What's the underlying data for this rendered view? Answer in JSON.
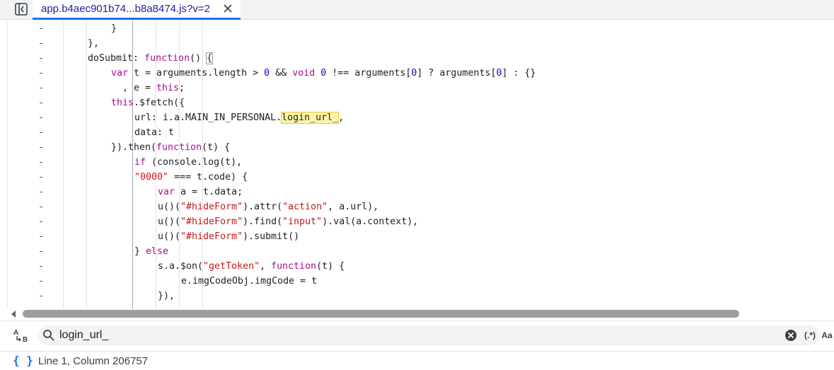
{
  "tab": {
    "title": "app.b4aec901b74...b8a8474.js?v=2"
  },
  "editor": {
    "gutter_marker": "-",
    "lines": [
      {
        "indent": 3,
        "html": "}"
      },
      {
        "indent": 2,
        "html": "},"
      },
      {
        "indent": 2,
        "html": "doSubmit: <span class=\"kw\">function</span>() <span class=\"bracket\">{</span>"
      },
      {
        "indent": 3,
        "html": "<span class=\"kw\">var</span> t = arguments.length &gt; <span class=\"num\">0</span> &amp;&amp; <span class=\"kw\">void</span> <span class=\"num\">0</span> !== arguments[<span class=\"num\">0</span>] ? arguments[<span class=\"num\">0</span>] : {}"
      },
      {
        "indent": 3,
        "html": "  , e = <span class=\"kw\">this</span>;"
      },
      {
        "indent": 3,
        "html": "<span class=\"kw\">this</span>.$fetch({"
      },
      {
        "indent": 4,
        "html": "url: i.a.MAIN_IN_PERSONAL.<span class=\"hl\">login_url_</span>,"
      },
      {
        "indent": 4,
        "html": "data: t"
      },
      {
        "indent": 3,
        "html": "}).then(<span class=\"kw\">function</span>(t) {"
      },
      {
        "indent": 4,
        "html": "<span class=\"kw\">if</span> (console.log(t),"
      },
      {
        "indent": 4,
        "html": "<span class=\"str\">\"0000\"</span> === t.code) {"
      },
      {
        "indent": 5,
        "html": "<span class=\"kw\">var</span> a = t.data;"
      },
      {
        "indent": 5,
        "html": "u()(<span class=\"str\">\"#hideForm\"</span>).attr(<span class=\"str\">\"action\"</span>, a.url),"
      },
      {
        "indent": 5,
        "html": "u()(<span class=\"str\">\"#hideForm\"</span>).find(<span class=\"str\">\"input\"</span>).val(a.context),"
      },
      {
        "indent": 5,
        "html": "u()(<span class=\"str\">\"#hideForm\"</span>).submit()"
      },
      {
        "indent": 4,
        "html": "} <span class=\"kw\">else</span>"
      },
      {
        "indent": 5,
        "html": "s.a.$on(<span class=\"str\">\"getToken\"</span>, <span class=\"kw\">function</span>(t) {"
      },
      {
        "indent": 6,
        "html": "e.imgCodeObj.imgCode = t"
      },
      {
        "indent": 5,
        "html": "}),"
      }
    ]
  },
  "search": {
    "query": "login_url_",
    "regex_label": "(.*)",
    "case_label": "Aa"
  },
  "status": {
    "position": "Line 1, Column 206757",
    "format_icon": "{ }"
  },
  "icons": {
    "sidebar_toggle": "sidebar-toggle-icon",
    "tab_close": "close-icon",
    "search": "search-icon",
    "clear": "clear-icon",
    "regex": "regex-icon",
    "match_case": "match-case-icon",
    "replace_toggle": "replace-toggle-icon",
    "pretty_print": "pretty-print-icon"
  },
  "colors": {
    "accent": "#1a73e8",
    "keyword": "#aa0d91",
    "string": "#c41a16",
    "number": "#1c00cf",
    "highlight": "#fff5a8"
  }
}
